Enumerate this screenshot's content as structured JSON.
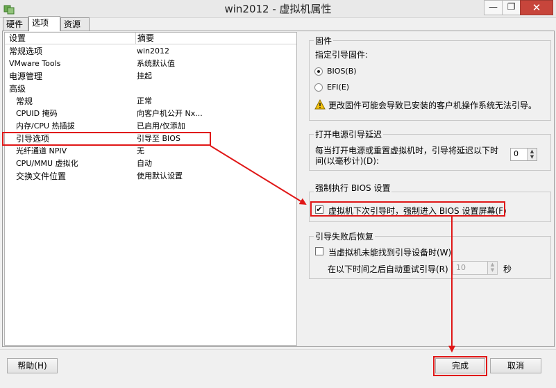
{
  "window": {
    "title": "win2012 - 虚拟机属性",
    "minimize": "—",
    "maximize": "❐",
    "close": "✕"
  },
  "tabs": [
    {
      "label": "硬件"
    },
    {
      "label": "选项"
    },
    {
      "label": "资源"
    }
  ],
  "list": {
    "headers": {
      "settings": "设置",
      "summary": "摘要"
    },
    "rows": [
      {
        "name": "常规选项",
        "value": "win2012"
      },
      {
        "name": "VMware Tools",
        "value": "系统默认值"
      },
      {
        "name": "电源管理",
        "value": "挂起"
      },
      {
        "name": "高级",
        "value": ""
      },
      {
        "name": "常规",
        "value": "正常"
      },
      {
        "name": "CPUID 掩码",
        "value": "向客户机公开 Nx..."
      },
      {
        "name": "内存/CPU 热插拔",
        "value": "已启用/仅添加"
      },
      {
        "name": "引导选项",
        "value": "引导至 BIOS"
      },
      {
        "name": "光纤通道 NPIV",
        "value": "无"
      },
      {
        "name": "CPU/MMU 虚拟化",
        "value": "自动"
      },
      {
        "name": "交换文件位置",
        "value": "使用默认设置"
      }
    ]
  },
  "firmware": {
    "title": "固件",
    "prompt": "指定引导固件:",
    "option_bios": "BIOS(B)",
    "option_efi": "EFI(E)",
    "selected": "BIOS(B)",
    "warning": "更改固件可能会导致已安装的客户机操作系统无法引导。"
  },
  "boot_delay": {
    "title": "打开电源引导延迟",
    "label_line1": "每当打开电源或重置虚拟机时，引导将延迟以下时",
    "label_line2": "间(以毫秒计)(D):",
    "value": "0"
  },
  "force_bios": {
    "title": "强制执行 BIOS 设置",
    "label": "虚拟机下次引导时，强制进入 BIOS 设置屏幕(F)",
    "checked": true
  },
  "boot_retry": {
    "title": "引导失败后恢复",
    "label": "当虚拟机未能找到引导设备时(W)",
    "checked": false,
    "retry_label": "在以下时间之后自动重试引导(R)",
    "retry_value": "10",
    "unit": "秒"
  },
  "buttons": {
    "help": "帮助(H)",
    "finish": "完成",
    "cancel": "取消"
  },
  "annotation_color": "#e01717"
}
